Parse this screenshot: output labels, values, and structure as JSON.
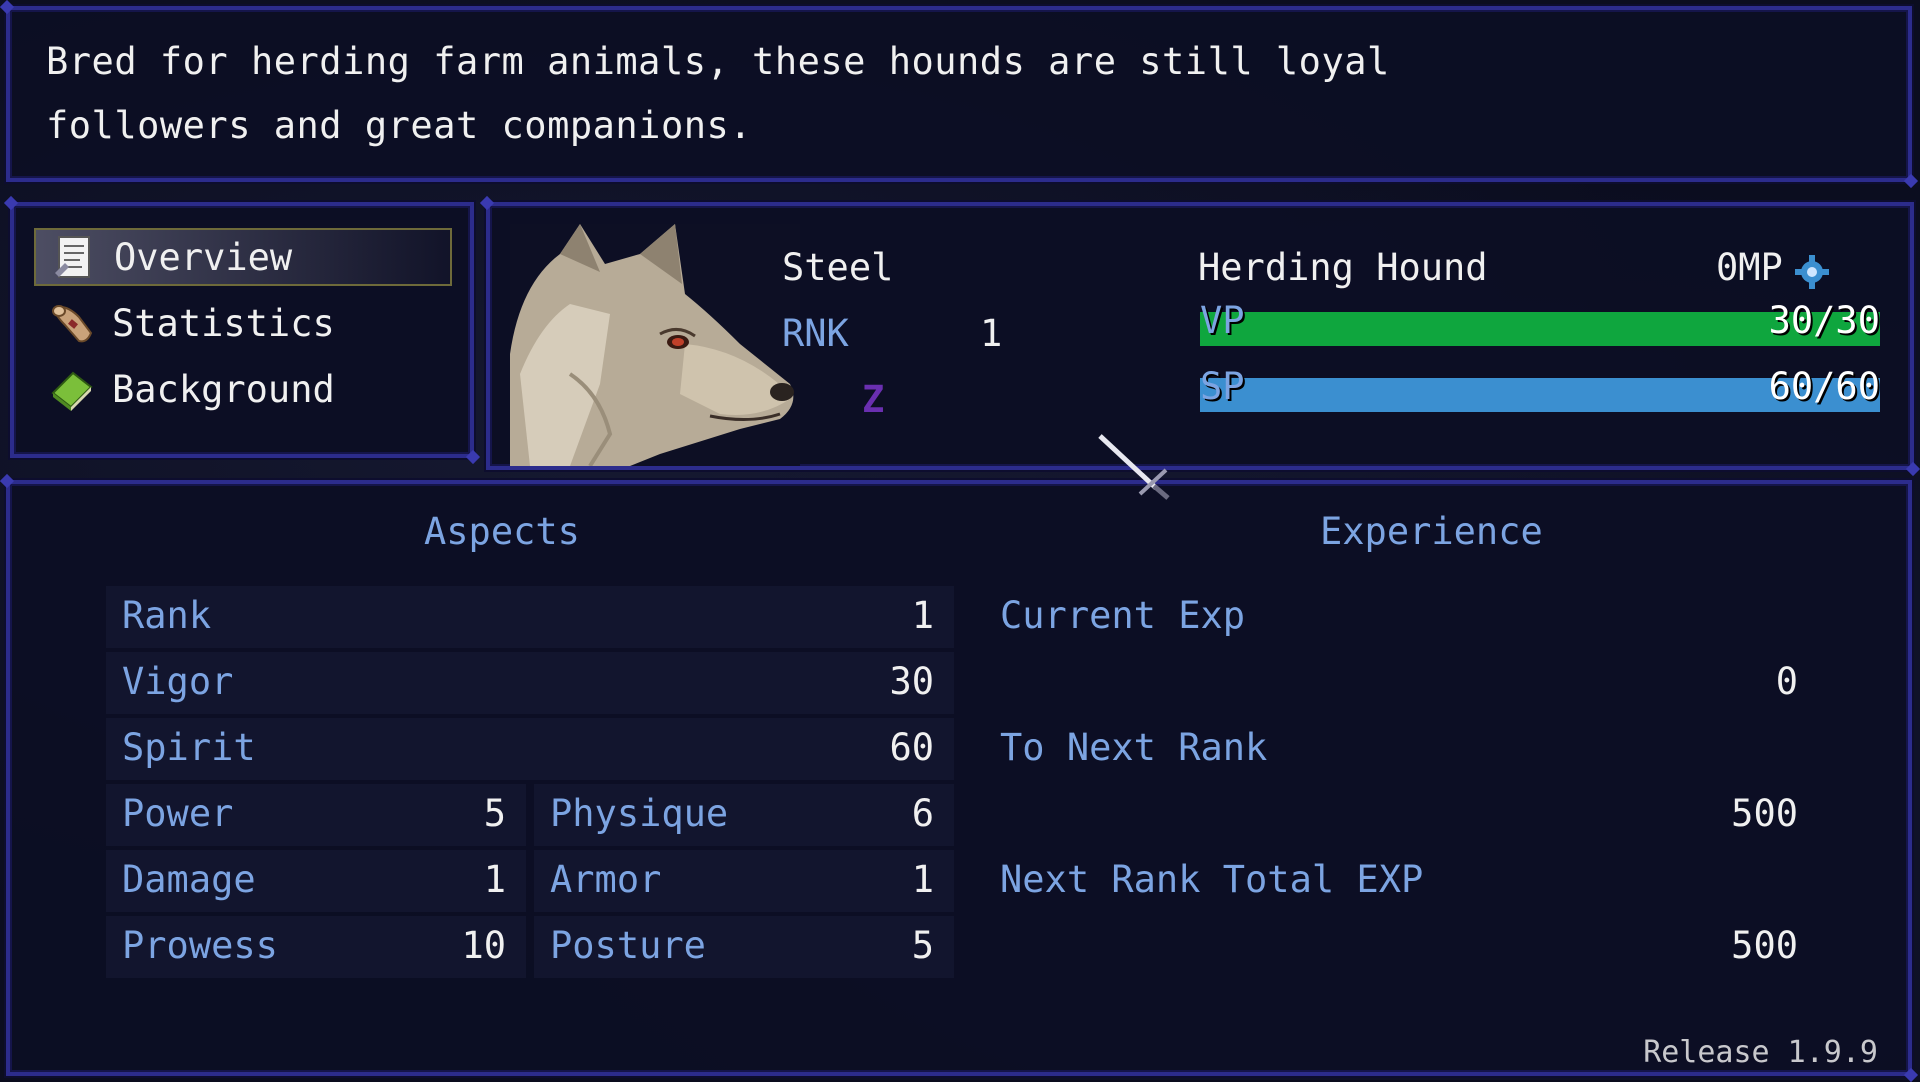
{
  "help": {
    "line1": "Bred for herding farm animals, these hounds are still loyal",
    "line2": "followers and great companions."
  },
  "menu": {
    "items": [
      {
        "label": "Overview",
        "icon": "scroll-document-icon",
        "selected": true
      },
      {
        "label": "Statistics",
        "icon": "rolled-scroll-icon",
        "selected": false
      },
      {
        "label": "Background",
        "icon": "green-book-icon",
        "selected": false
      }
    ]
  },
  "status": {
    "material": "Steel",
    "rank_label": "RNK",
    "rank_value": "1",
    "state_symbol": "Z",
    "name": "Herding Hound",
    "mp": "0MP",
    "vp": {
      "label": "VP",
      "value": "30/30",
      "fill": 1.0,
      "color": "#0fa63e"
    },
    "sp": {
      "label": "SP",
      "value": "60/60",
      "fill": 1.0,
      "color": "#3b8fd0"
    }
  },
  "aspects": {
    "title": "Aspects",
    "rows": [
      {
        "label": "Rank",
        "value": "1"
      },
      {
        "label": "Vigor",
        "value": "30"
      },
      {
        "label": "Spirit",
        "value": "60"
      }
    ],
    "pairs": [
      {
        "l1": "Power",
        "v1": "5",
        "l2": "Physique",
        "v2": "6"
      },
      {
        "l1": "Damage",
        "v1": "1",
        "l2": "Armor",
        "v2": "1"
      },
      {
        "l1": "Prowess",
        "v1": "10",
        "l2": "Posture",
        "v2": "5"
      }
    ]
  },
  "experience": {
    "title": "Experience",
    "current_label": "Current Exp",
    "current_value": "0",
    "next_label": "To Next Rank",
    "next_value": "500",
    "total_label": "Next Rank Total EXP",
    "total_value": "500"
  },
  "release": "Release 1.9.9"
}
